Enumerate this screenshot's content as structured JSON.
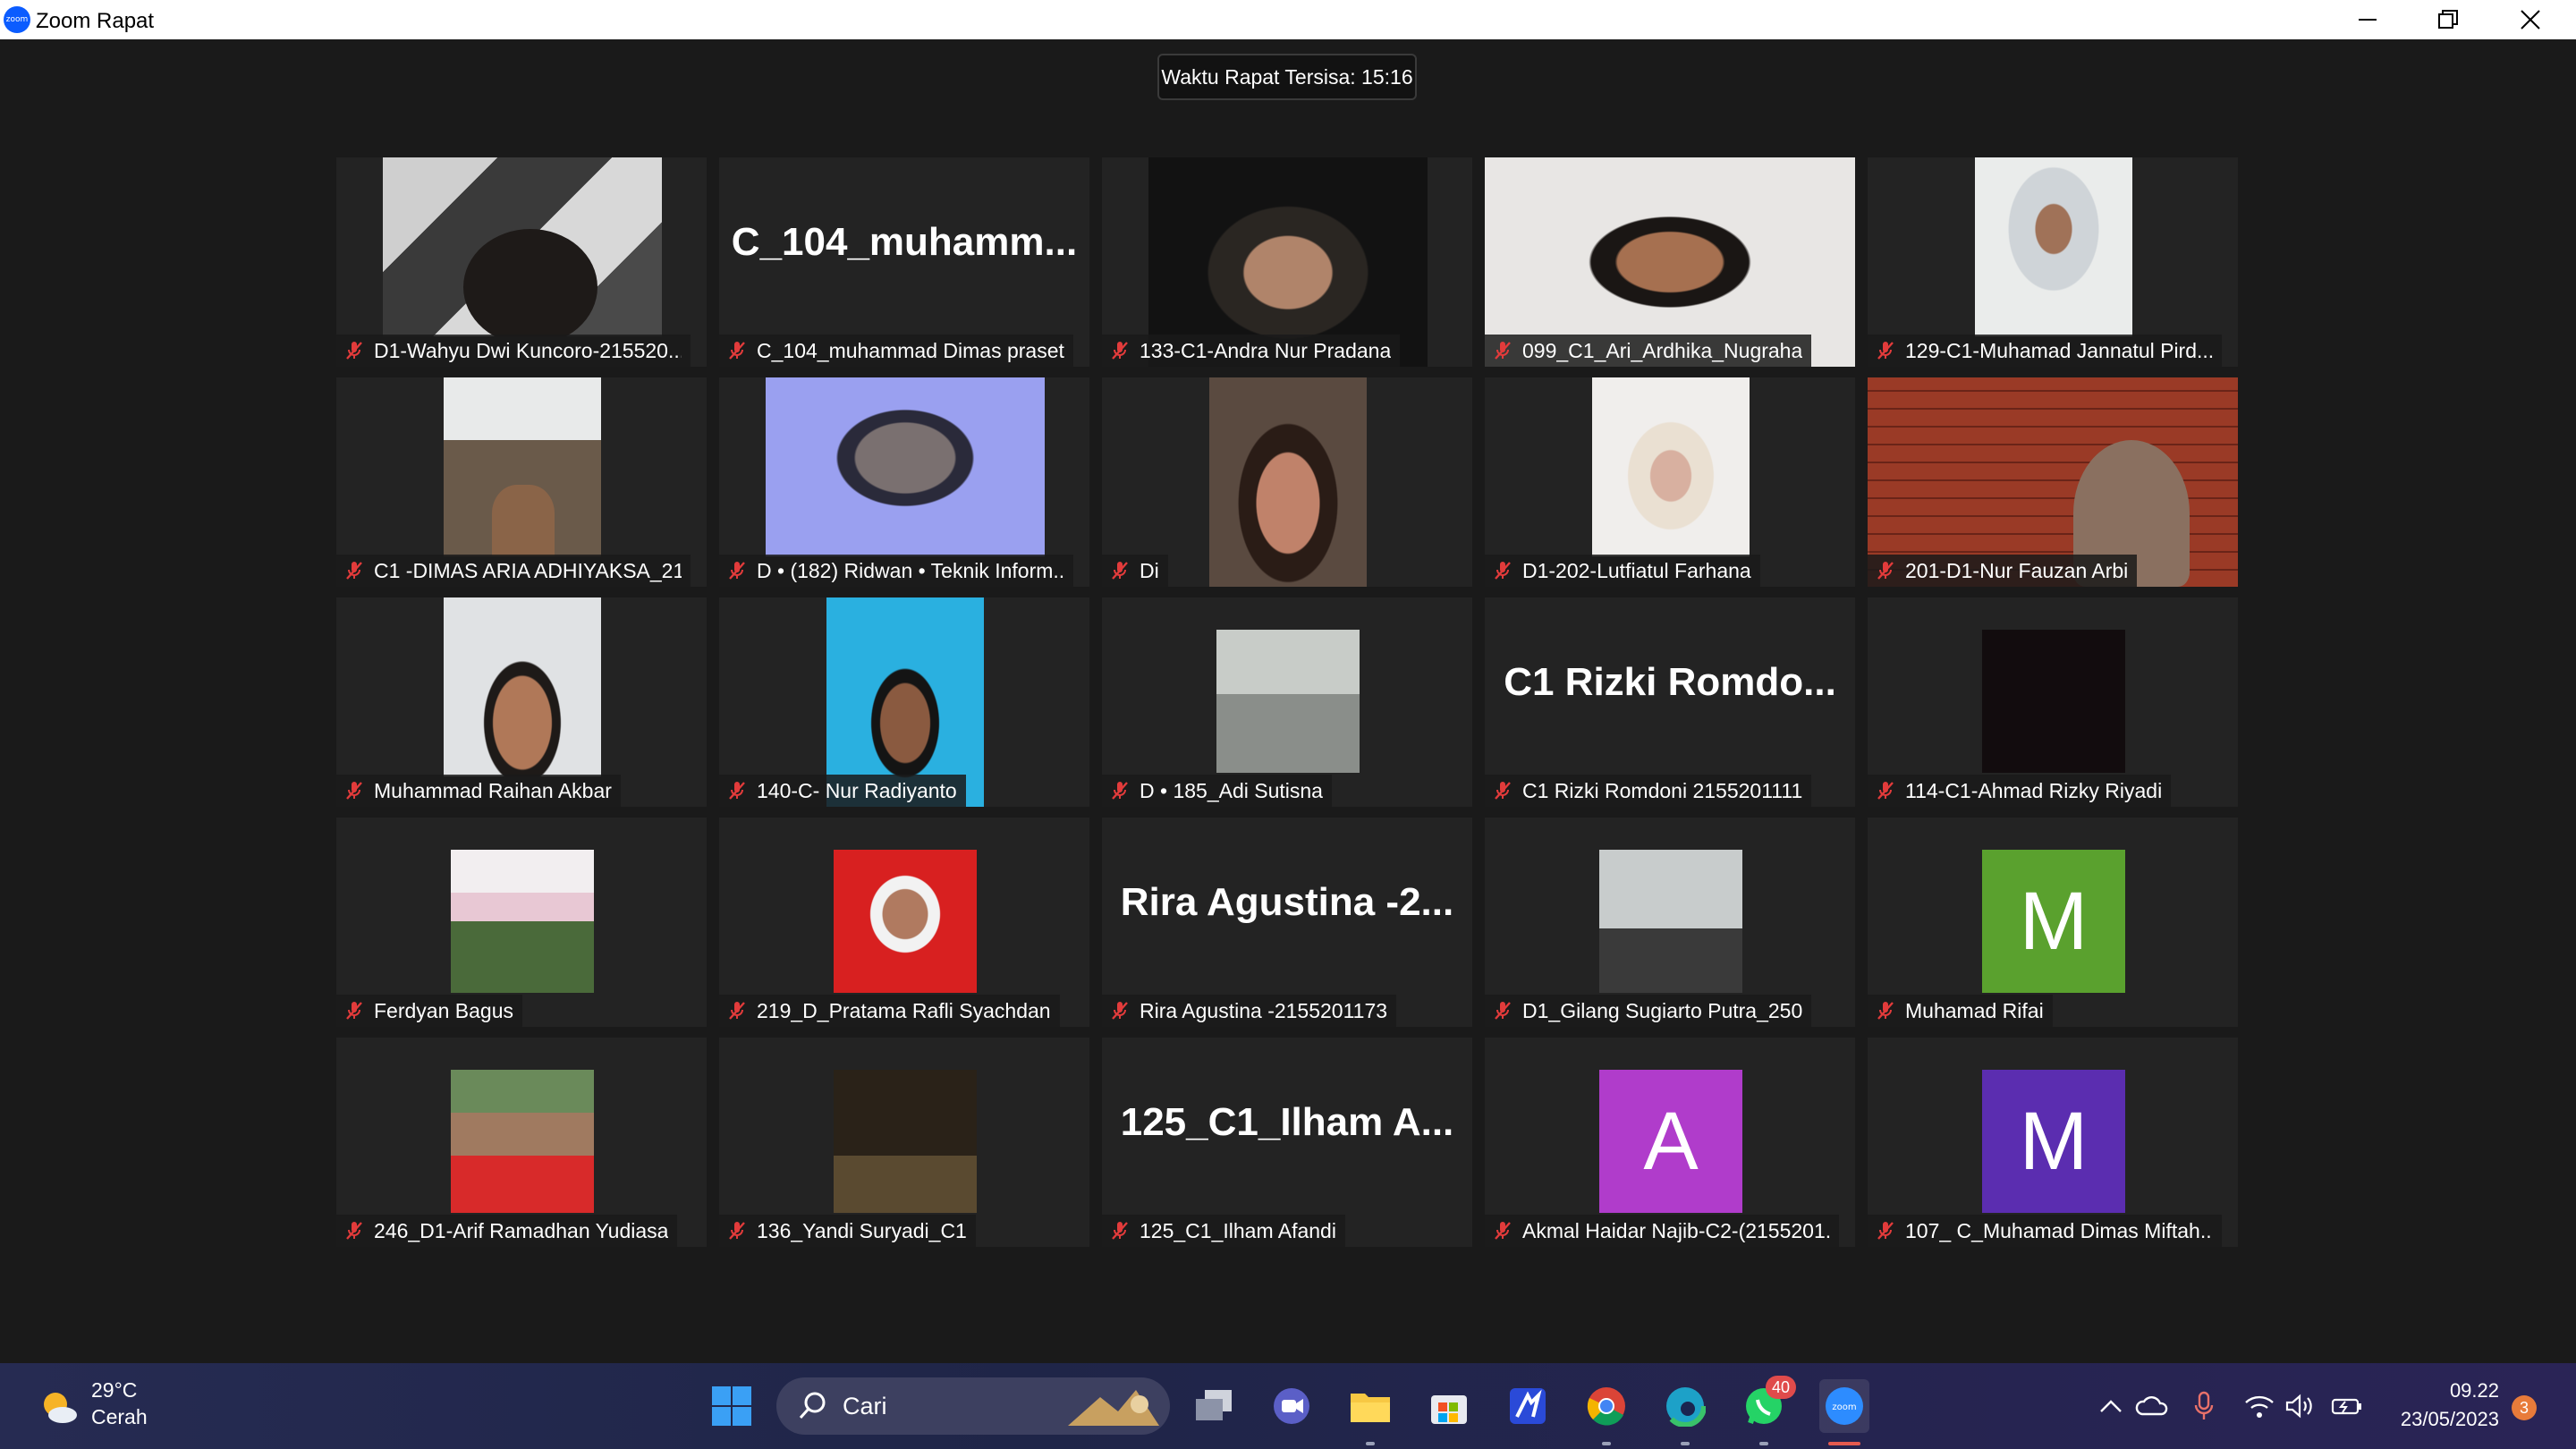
{
  "window": {
    "title": "Zoom Rapat",
    "logo_text": "zoom"
  },
  "meeting": {
    "timer": "Waktu Rapat Tersisa: 15:16"
  },
  "participants": [
    {
      "name": "D1-Wahyu Dwi Kuncoro-215520...",
      "muted": true,
      "view": "video"
    },
    {
      "name": "C_104_muhammad Dimas praset...",
      "display_name": "C_104_muhamm...",
      "muted": true,
      "view": "name"
    },
    {
      "name": "133-C1-Andra Nur Pradana",
      "muted": true,
      "view": "video"
    },
    {
      "name": "099_C1_Ari_Ardhika_Nugraha",
      "muted": true,
      "view": "video"
    },
    {
      "name": "129-C1-Muhamad Jannatul Pird...",
      "muted": true,
      "view": "video"
    },
    {
      "name": "C1 -DIMAS ARIA ADHIYAKSA_21...",
      "muted": true,
      "view": "video"
    },
    {
      "name": "D • (182) Ridwan • Teknik Inform...",
      "muted": true,
      "view": "video"
    },
    {
      "name": "Di",
      "muted": true,
      "view": "video"
    },
    {
      "name": "D1-202-Lutfiatul Farhana",
      "muted": true,
      "view": "video"
    },
    {
      "name": "201-D1-Nur Fauzan Arbi",
      "muted": true,
      "view": "video"
    },
    {
      "name": "Muhammad Raihan Akbar",
      "muted": true,
      "view": "video"
    },
    {
      "name": "140-C- Nur Radiyanto",
      "muted": true,
      "view": "video"
    },
    {
      "name": "D • 185_Adi Sutisna",
      "muted": true,
      "view": "photo"
    },
    {
      "name": "C1 Rizki Romdoni 2155201111",
      "display_name": "C1 Rizki Romdo...",
      "muted": true,
      "view": "name"
    },
    {
      "name": "114-C1-Ahmad Rizky Riyadi",
      "muted": true,
      "view": "photo"
    },
    {
      "name": "Ferdyan Bagus",
      "muted": true,
      "view": "photo"
    },
    {
      "name": "219_D_Pratama Rafli Syachdan",
      "muted": true,
      "view": "photo"
    },
    {
      "name": "Rira Agustina -2155201173",
      "display_name": "Rira Agustina -2...",
      "muted": true,
      "view": "name"
    },
    {
      "name": "D1_Gilang Sugiarto Putra_250",
      "muted": true,
      "view": "photo"
    },
    {
      "name": "Muhamad Rifai",
      "avatar_letter": "M",
      "avatar_color": "#5aa12e",
      "muted": true,
      "view": "avatar"
    },
    {
      "name": "246_D1-Arif Ramadhan Yudiasa",
      "muted": true,
      "view": "photo"
    },
    {
      "name": "136_Yandi Suryadi_C1",
      "muted": true,
      "view": "photo"
    },
    {
      "name": "125_C1_Ilham Afandi",
      "display_name": "125_C1_Ilham  A...",
      "muted": true,
      "view": "name"
    },
    {
      "name": "Akmal Haidar Najib-C2-(2155201...",
      "avatar_letter": "A",
      "avatar_color": "#b03ccb",
      "muted": true,
      "view": "avatar"
    },
    {
      "name": "107_ C_Muhamad Dimas Miftah...",
      "avatar_letter": "M",
      "avatar_color": "#5b2db0",
      "muted": true,
      "view": "avatar"
    }
  ],
  "taskbar": {
    "weather": {
      "temp": "29°C",
      "desc": "Cerah"
    },
    "search_placeholder": "Cari",
    "whatsapp_badge": "40",
    "clock": {
      "time": "09.22",
      "date": "23/05/2023"
    },
    "notifications": "3"
  }
}
